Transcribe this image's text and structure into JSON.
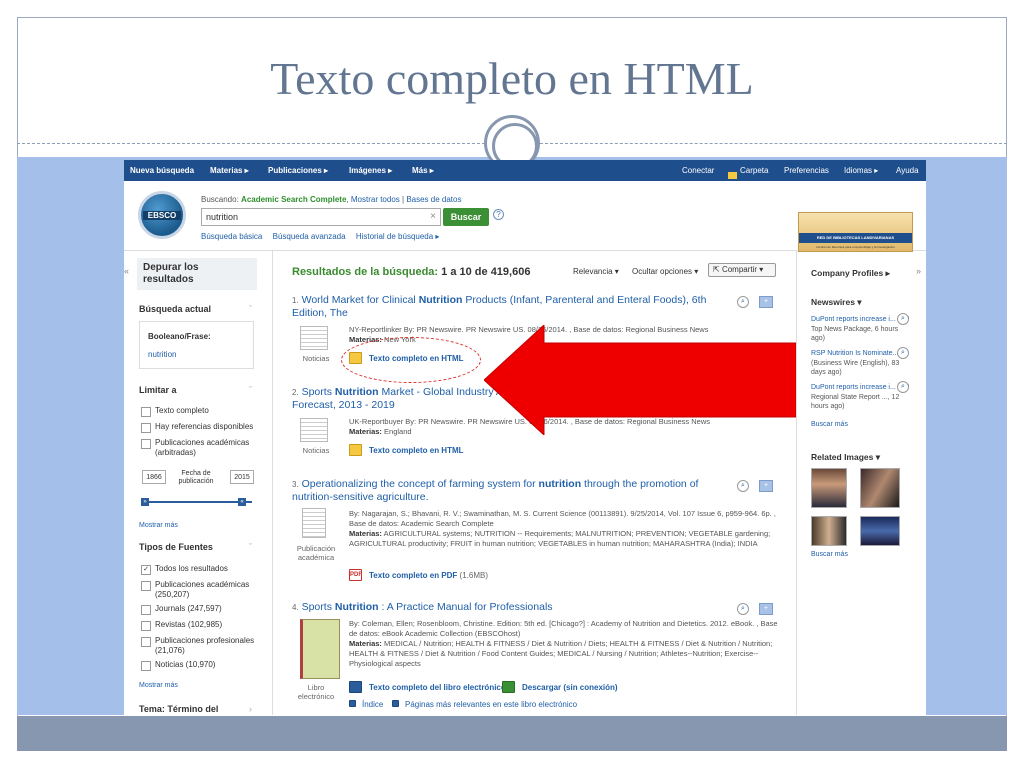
{
  "slide": {
    "title": "Texto completo en HTML"
  },
  "nav": {
    "new_search": "Nueva búsqueda",
    "subjects": "Materias ▸",
    "publications": "Publicaciones ▸",
    "images": "Imágenes ▸",
    "more": "Más ▸",
    "connect": "Conectar",
    "folder": "Carpeta",
    "preferences": "Preferencias",
    "languages": "Idiomas ▸",
    "help": "Ayuda"
  },
  "header": {
    "logo": "EBSCO",
    "searching_label": "Buscando:",
    "database": "Academic Search Complete",
    "show_all": "Mostrar todos",
    "databases": "Bases de datos",
    "search_value": "nutrition",
    "search_button": "Buscar",
    "help_icon": "?",
    "basic": "Búsqueda básica",
    "advanced": "Búsqueda avanzada",
    "history": "Historial de búsqueda ▸",
    "library_banner": "RED DE BIBLIOTECAS LANDIVARIANAS",
    "library_sub": "Centros de Recursos para el Aprendizaje y la Investigación"
  },
  "left": {
    "refine": "Depurar los resultados",
    "current_search": "Búsqueda actual",
    "boolean_label": "Booleano/Frase:",
    "boolean_value": "nutrition",
    "limit_to": "Limitar a",
    "limits": [
      "Texto completo",
      "Hay referencias disponibles",
      "Publicaciones académicas (arbitradas)"
    ],
    "year_from": "1866",
    "year_to": "2015",
    "date_label": "Fecha de publicación",
    "show_more": "Mostrar más",
    "source_types": "Tipos de Fuentes",
    "sources": [
      "Todos los resultados",
      "Publicaciones académicas (250,207)",
      "Journals (247,597)",
      "Revistas (102,985)",
      "Publicaciones profesionales (21,076)",
      "Noticias (10,970)"
    ],
    "show_more2": "Mostrar más",
    "subject_term": "Tema: Término del"
  },
  "results": {
    "heading_label": "Resultados de la búsqueda:",
    "heading_range": "1 a 10 de 419,606",
    "relevance": "Relevancia ▾",
    "hide_options": "Ocultar opciones ▾",
    "share": "Compartir ▾",
    "items": [
      {
        "num": "1.",
        "title_a": "World Market for Clinical ",
        "title_b": "Nutrition",
        "title_c": " Products (Infant, Parenteral and Enteral Foods), 6th Edition, The",
        "type": "Noticias",
        "meta1": "NY-Reportlinker By: PR Newswire. PR Newswire US. 08/26/2014. , Base de datos: Regional Business News",
        "meta2_label": "Materias:",
        "meta2": " New York",
        "link": "Texto completo en HTML"
      },
      {
        "num": "2.",
        "title_a": "Sports ",
        "title_b": "Nutrition",
        "title_c": " Market - Global Industry Analysis, Size, Share, Growth, Trends and Forecast, 2013 - 2019",
        "type": "Noticias",
        "meta1": "UK-Reportbuyer By: PR Newswire. PR Newswire US. 05/06/2014. , Base de datos: Regional Business News",
        "meta2_label": "Materias:",
        "meta2": " England",
        "link": "Texto completo en HTML"
      },
      {
        "num": "3.",
        "title_a": "Operationalizing the concept of farming system for ",
        "title_b": "nutrition",
        "title_c": " through the promotion of nutrition-sensitive agriculture.",
        "type": "Publicación académica",
        "meta1": "By: Nagarajan, S.; Bhavani, R. V.; Swaminathan, M. S. Current Science (00113891). 9/25/2014, Vol. 107 Issue 6, p959-964. 6p. , Base de datos: Academic Search Complete",
        "meta2_label": "Materias:",
        "meta2": " AGRICULTURAL systems; NUTRITION -- Requirements; MALNUTRITION; PREVENTION; VEGETABLE gardening; AGRICULTURAL productivity; FRUIT in human nutrition; VEGETABLES in human nutrition; MAHARASHTRA (India); INDIA",
        "link": "Texto completo en PDF",
        "link_size": "(1.6MB)"
      },
      {
        "num": "4.",
        "title_a": "Sports ",
        "title_b": "Nutrition",
        "title_c": " : A Practice Manual for Professionals",
        "type": "Libro electrónico",
        "meta1": "By: Coleman, Ellen; Rosenbloom, Christine. Edition: 5th ed. [Chicago?] : Academy of Nutrition and Dietetics. 2012. eBook. , Base de datos: eBook Academic Collection (EBSCOhost)",
        "meta2_label": "Materias:",
        "meta2": " MEDICAL / Nutrition; HEALTH & FITNESS / Diet & Nutrition / Diets; HEALTH & FITNESS / Diet & Nutrition / Nutrition; HEALTH & FITNESS / Diet & Nutrition / Food Content Guides; MEDICAL / Nursing / Nutrition; Athletes--Nutrition; Exercise--Physiological aspects",
        "link": "Texto completo del libro electrónico",
        "download": "Descargar (sin conexión)",
        "index": "Índice",
        "relevant_pages": "Páginas más relevantes en este libro electrónico"
      }
    ]
  },
  "right": {
    "company_profiles": "Company Profiles ▸",
    "newswires": "Newswires ▾",
    "news": [
      {
        "title": "DuPont reports increase i...",
        "meta": "(AP Top News Package, 6 hours ago)"
      },
      {
        "title": "RSP Nutrition Is Nominate...",
        "meta": "(Business Wire (English), 83 days ago)"
      },
      {
        "title": "DuPont reports increase i...",
        "meta": "(AP Regional State Report ..., 12 hours ago)"
      }
    ],
    "search_more": "Buscar más",
    "related_images": "Related Images ▾",
    "search_more2": "Buscar más"
  }
}
